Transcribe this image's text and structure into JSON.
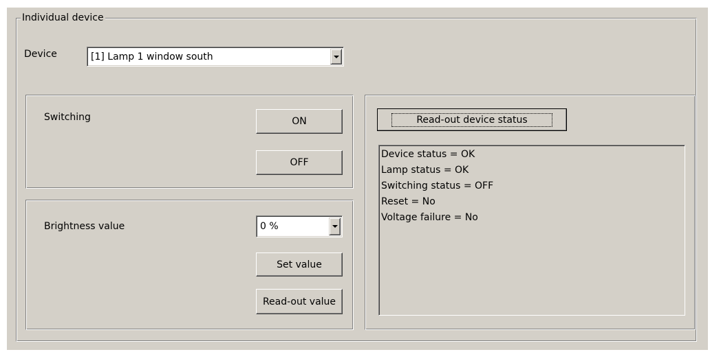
{
  "group": {
    "title": "Individual device"
  },
  "device": {
    "label": "Device",
    "selected": "[1] Lamp 1 window south"
  },
  "switching": {
    "label": "Switching",
    "on_label": "ON",
    "off_label": "OFF"
  },
  "brightness": {
    "label": "Brightness value",
    "selected": "0 %",
    "set_label": "Set value",
    "readout_label": "Read-out value"
  },
  "status": {
    "readout_button": "Read-out device status",
    "lines": [
      "Device status = OK",
      "Lamp status = OK",
      "Switching status = OFF",
      "Reset = No",
      "Voltage failure = No"
    ]
  }
}
